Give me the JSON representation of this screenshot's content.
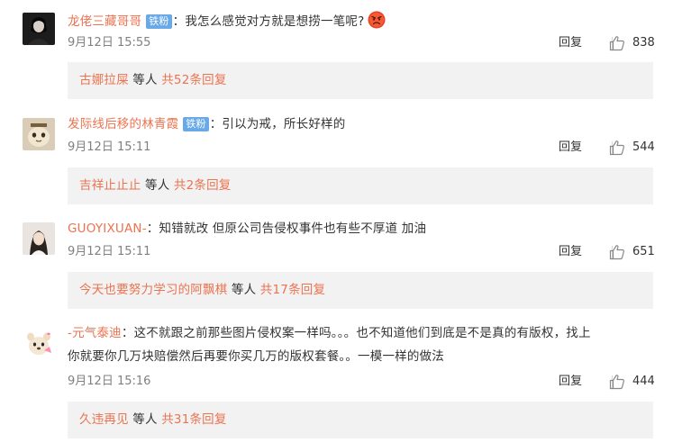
{
  "comments": [
    {
      "username": "龙佬三藏哥哥",
      "badge": "铁粉",
      "separator": "：",
      "text": "我怎么感觉对方就是想捞一笔呢?",
      "text2": "",
      "emoji": "angry-face-emoji",
      "time": "9月12日  15:55",
      "reply_label": "回复",
      "likes": "838",
      "reply_user": "古娜拉屎",
      "reply_etc": " 等人 ",
      "reply_more": "共52条回复"
    },
    {
      "username": "发际线后移的林青霞",
      "badge": "铁粉",
      "separator": "：",
      "text": "引以为戒，所长好样的",
      "text2": "",
      "time": "9月12日  15:11",
      "reply_label": "回复",
      "likes": "544",
      "reply_user": "吉祥止止止",
      "reply_etc": " 等人 ",
      "reply_more": "共2条回复"
    },
    {
      "username": "GUOYIXUAN-",
      "badge": "",
      "separator": "：",
      "text": "知错就改 但原公司告侵权事件也有些不厚道 加油",
      "text2": "",
      "time": "9月12日  15:11",
      "reply_label": "回复",
      "likes": "651",
      "reply_user": "今天也要努力学习的阿飘棋",
      "reply_etc": " 等人 ",
      "reply_more": "共17条回复"
    },
    {
      "username": "-元气泰迪",
      "badge": "",
      "separator": "：",
      "text": "这不就跟之前那些图片侵权案一样吗。。。也不知道他们到底是不是真的有版权，找上",
      "text2": "你就要你几万块赔偿然后再要你买几万的版权套餐。。一模一样的做法",
      "time": "9月12日  15:16",
      "reply_label": "回复",
      "likes": "444",
      "reply_user": "久违再见",
      "reply_etc": " 等人 ",
      "reply_more": "共31条回复"
    }
  ],
  "colors": {
    "username": "#eb7350",
    "badge_bg": "#6aa9e8",
    "reply_box_bg": "#f2f2f2",
    "meta": "#808080"
  }
}
